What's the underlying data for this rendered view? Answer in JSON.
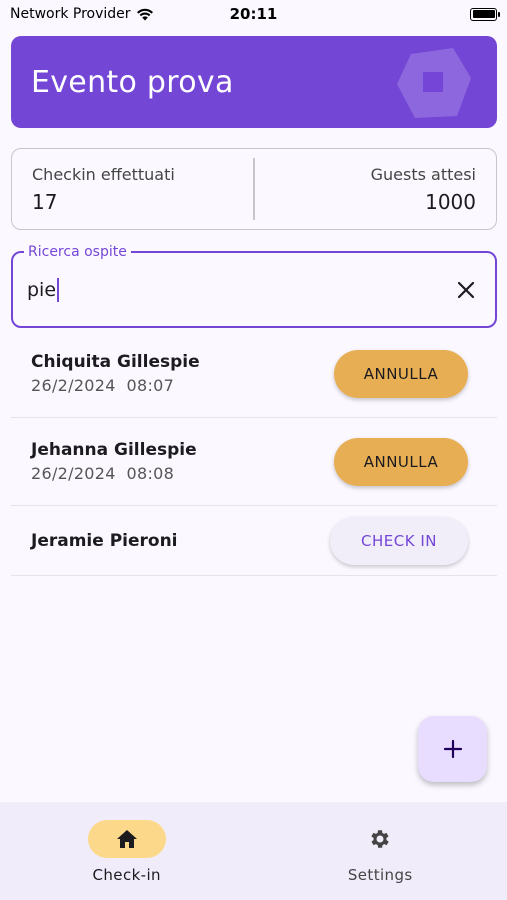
{
  "status_bar": {
    "carrier": "Network Provider",
    "time": "20:11"
  },
  "header": {
    "title": "Evento prova"
  },
  "stats": {
    "checkin_label": "Checkin effettuati",
    "checkin_value": "17",
    "guests_label": "Guests attesi",
    "guests_value": "1000"
  },
  "search": {
    "label": "Ricerca ospite",
    "value": "pie"
  },
  "guests": [
    {
      "name": "Chiquita Gillespie",
      "date": "26/2/2024",
      "time": "08:07",
      "action": "ANNULLA"
    },
    {
      "name": "Jehanna Gillespie",
      "date": "26/2/2024",
      "time": "08:08",
      "action": "ANNULLA"
    },
    {
      "name": "Jeramie Pieroni",
      "action": "CHECK IN"
    }
  ],
  "nav": {
    "checkin_label": "Check-in",
    "settings_label": "Settings"
  },
  "colors": {
    "primary": "#7446d6",
    "annulla": "#e8ae54",
    "nav_active": "#fcd98a",
    "fab": "#e9ddff"
  },
  "icons": {
    "wifi": "wifi-icon",
    "battery": "battery-icon",
    "clear": "close-icon",
    "fab": "plus-icon",
    "home": "home-icon",
    "settings": "gear-icon"
  }
}
